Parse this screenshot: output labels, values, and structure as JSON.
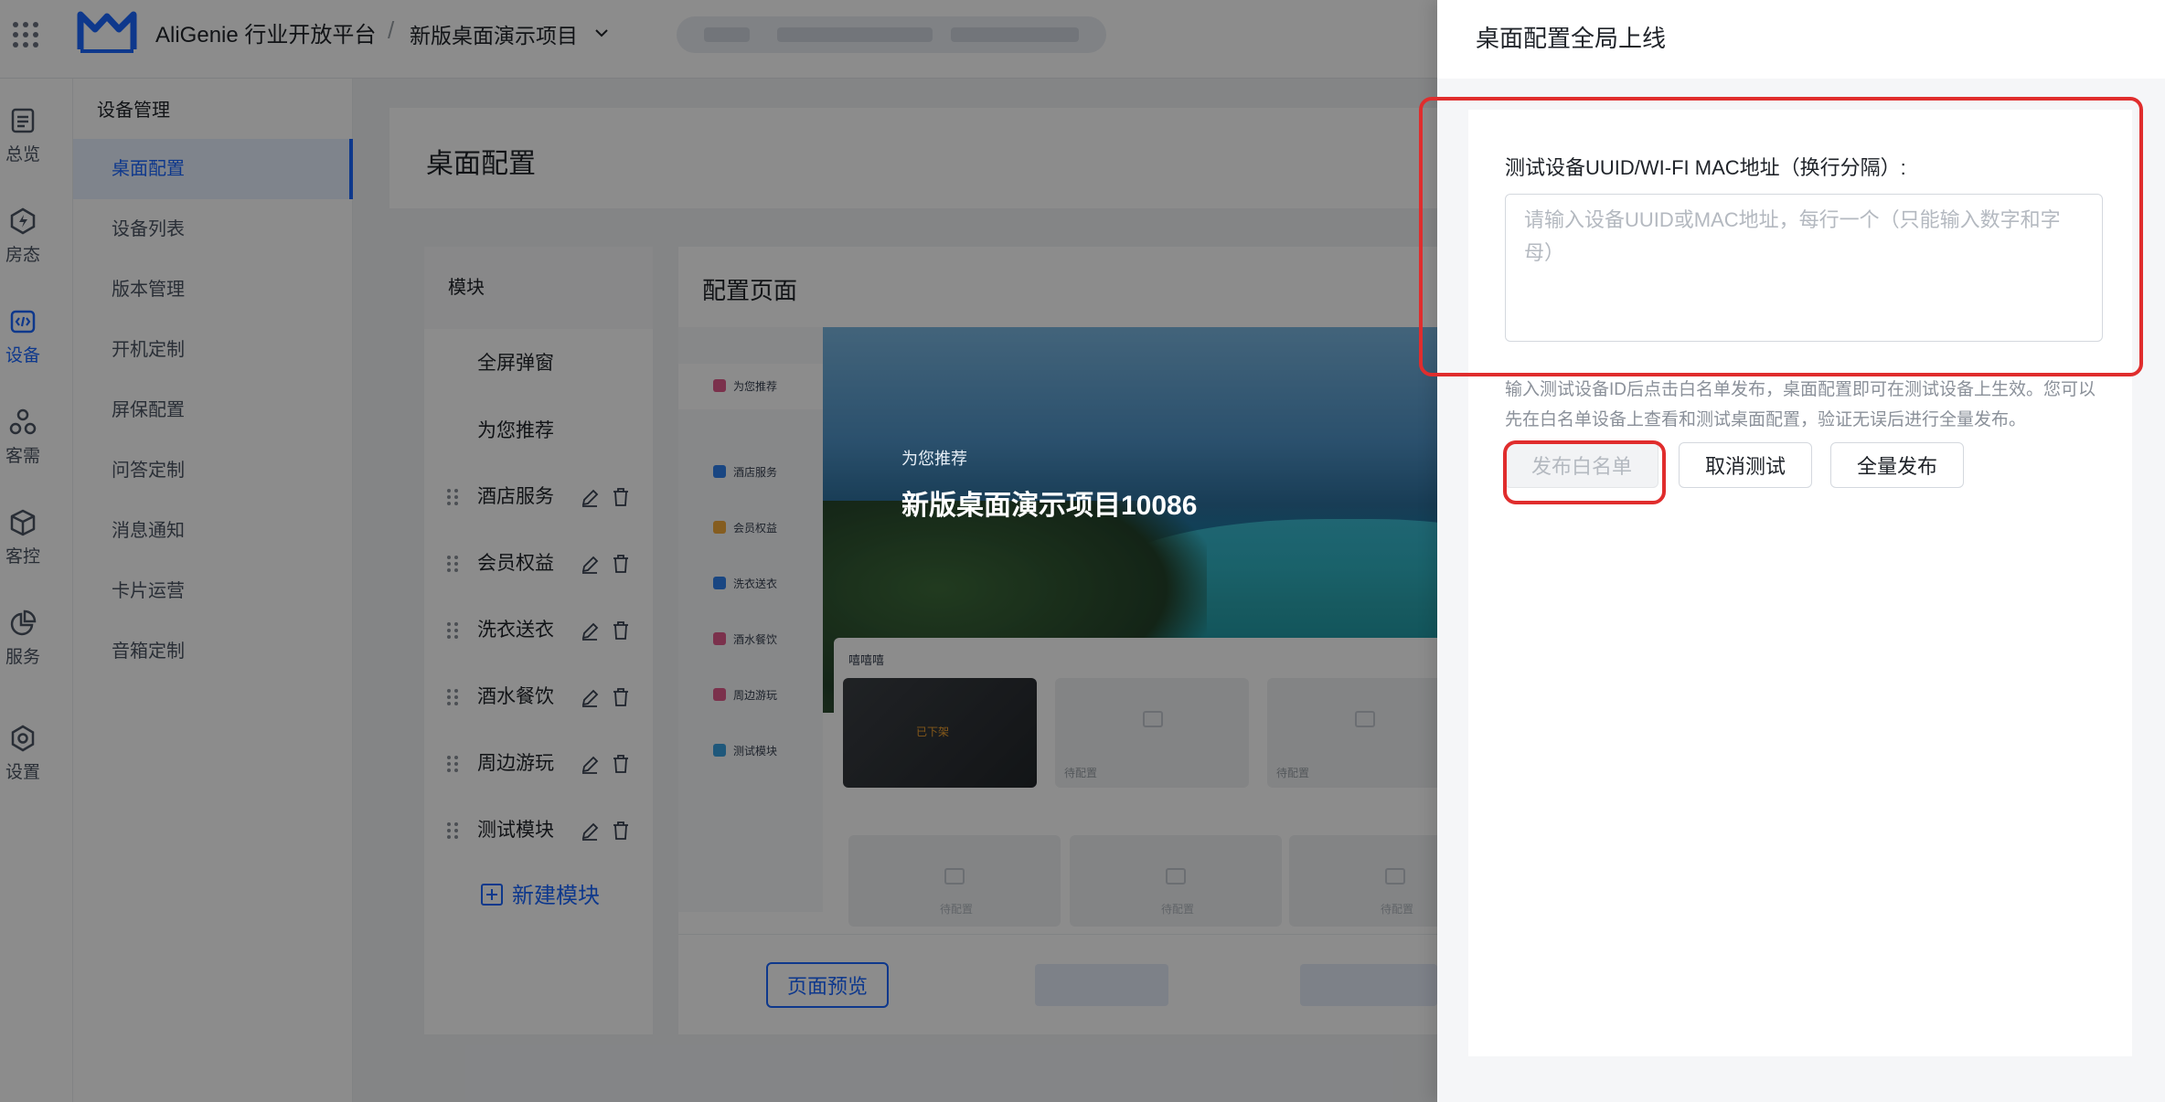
{
  "header": {
    "brand": "AliGenie 行业开放平台",
    "separator": "/",
    "project": "新版桌面演示项目"
  },
  "rail": {
    "items": [
      {
        "label": "总览",
        "icon": "overview-icon"
      },
      {
        "label": "房态",
        "icon": "lightning-icon"
      },
      {
        "label": "设备",
        "icon": "code-icon"
      },
      {
        "label": "客需",
        "icon": "shapes-icon"
      },
      {
        "label": "客控",
        "icon": "cube-icon"
      },
      {
        "label": "服务",
        "icon": "pie-chart-icon"
      },
      {
        "label": "设置",
        "icon": "gear-icon"
      }
    ]
  },
  "subnav": {
    "title": "设备管理",
    "items": [
      "桌面配置",
      "设备列表",
      "版本管理",
      "开机定制",
      "屏保配置",
      "问答定制",
      "消息通知",
      "卡片运营",
      "音箱定制"
    ]
  },
  "page": {
    "title": "桌面配置"
  },
  "modules": {
    "header": "模块",
    "fixed": [
      "全屏弹窗",
      "为您推荐"
    ],
    "editable": [
      "酒店服务",
      "会员权益",
      "洗衣送衣",
      "酒水餐饮",
      "周边游玩",
      "测试模块"
    ],
    "new_label": "新建模块"
  },
  "config": {
    "title": "配置页面",
    "side_items": [
      "为您推荐",
      "酒店服务",
      "会员权益",
      "洗衣送衣",
      "酒水餐饮",
      "周边游玩",
      "测试模块"
    ],
    "hero_sub": "为您推荐",
    "hero_title": "新版桌面演示项目10086",
    "strip_title": "嘻嘻嘻",
    "badge": "已下架",
    "pending": "待配置",
    "preview_button": "页面预览"
  },
  "drawer": {
    "title": "桌面配置全局上线",
    "field_label": "测试设备UUID/WI-FI MAC地址（换行分隔）:",
    "input_value": "",
    "input_placeholder": "请输入设备UUID或MAC地址，每行一个（只能输入数字和字母）",
    "helper": "输入测试设备ID后点击白名单发布，桌面配置即可在测试设备上生效。您可以先在白名单设备上查看和测试桌面配置，验证无误后进行全量发布。",
    "buttons": {
      "whitelist": "发布白名单",
      "cancel_test": "取消测试",
      "full_release": "全量发布"
    }
  },
  "colors": {
    "accent": "#1a66ff",
    "highlight": "#e02d2d",
    "overlay": "rgba(0,0,0,0.45)"
  }
}
